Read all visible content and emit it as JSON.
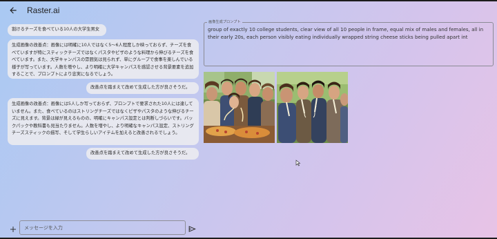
{
  "header": {
    "title": "Raster.ai",
    "back_icon": "arrow-left-icon"
  },
  "chat": {
    "messages": [
      {
        "role": "user",
        "text": "割けるチーズを食べている10人の大学生男女"
      },
      {
        "role": "assistant",
        "text": "生成画像の改善点：画像には明確に10人ではなく5〜6人程度しか映っておらず、チーズを食べていますが特にスティックチーズではなくパスタやピザのような料理から伸びるチーズを食べています。また、大学キャンパスの雰囲気は見られず、単にグループで食事を楽しんでいる様子が写っています。人数を増やし、より明確に大学キャンパスを感認させる背景要素を追加することで、プロンプトにより忠実になるでしょう。"
      },
      {
        "role": "user",
        "text": "改善点を踏まえて改めて生成した方が良さそうだ。"
      },
      {
        "role": "assistant",
        "text": "生成画像の改善点：画像には5人しか写っておらず、プロンプトで要求された10人には達していません。また、食べているのはストリングチーズではなくピザやパスタのような伸びるチーズに見えます。背景は緑が見えるものの、明確にキャンパス設定とは判断しづらいです。バックパックや教科書も見当たりません。人数を増やし、より明確なキャンパス設定、ストリングチーズスティックの描写、そして学生らしいアイテムを加えると改善されるでしょう。"
      },
      {
        "role": "user",
        "text": "改善点を踏まえて改めて生成した方が良さそうだ。"
      }
    ]
  },
  "input": {
    "placeholder": "メッセージを入力",
    "value": "",
    "add_icon": "plus-icon",
    "send_icon": "send-icon"
  },
  "prompt_panel": {
    "label": "画像生成プロンプト",
    "text": "group of exactly 10 college students, clear view of all 10 people in frame, equal mix of males and females, all in their early 20s, each person visibly eating individually wrapped string cheese sticks being pulled apart int"
  },
  "images": [
    {
      "name": "generated-image-1"
    },
    {
      "name": "generated-image-2"
    }
  ],
  "colors": {
    "bubble": "#eaeaf0",
    "accent": "#1f1f1f"
  }
}
